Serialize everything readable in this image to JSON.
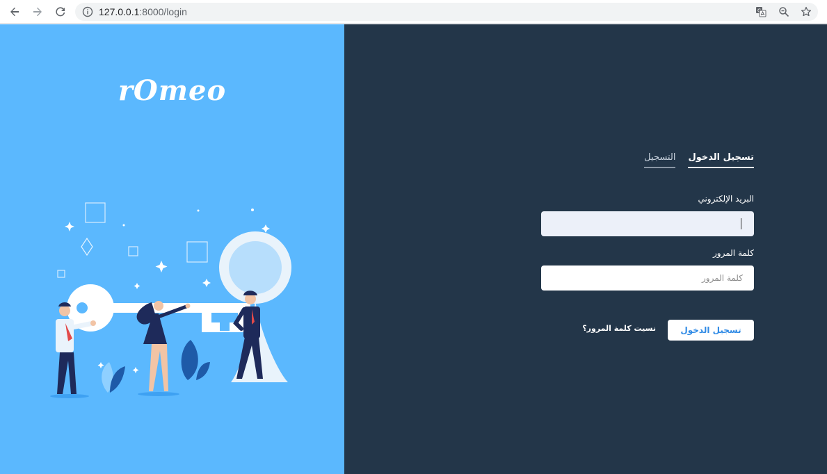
{
  "browser": {
    "url_host": "127.0.0.1",
    "url_path": ":8000/login",
    "icons": [
      "back-icon",
      "forward-icon",
      "reload-icon",
      "info-icon",
      "translate-icon",
      "zoom-icon",
      "bookmark-star-icon"
    ]
  },
  "brand": {
    "logo_text": "rOmeo",
    "panel_color": "#5bb8fe"
  },
  "auth": {
    "tabs": [
      {
        "label": "تسجيل الدخول",
        "active": true
      },
      {
        "label": "التسجيل",
        "active": false
      }
    ],
    "email_label": "البريد الإلكتروني",
    "email_value": "",
    "password_label": "كلمة المرور",
    "password_placeholder": "كلمة المرور",
    "submit_label": "تسجيل الدخول",
    "forgot_label": "نسيت كلمة المرور؟",
    "panel_color": "#233649",
    "accent_color": "#2f8ae5"
  }
}
